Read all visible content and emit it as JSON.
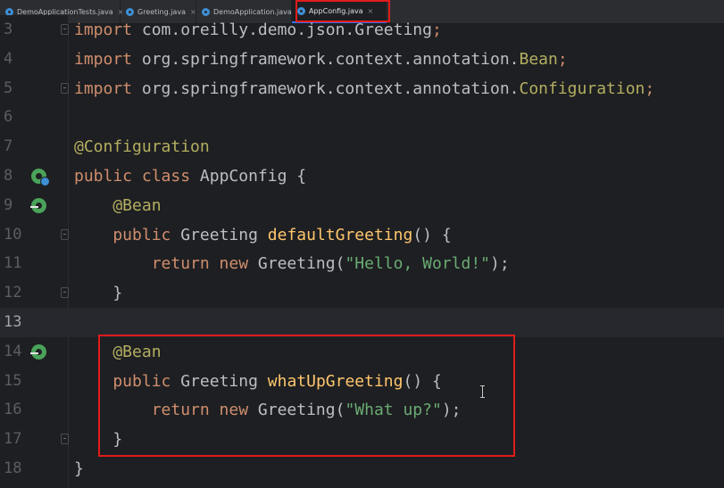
{
  "tabs": [
    {
      "label": "DemoApplicationTests.java",
      "active": false
    },
    {
      "label": "Greeting.java",
      "active": false
    },
    {
      "label": "DemoApplication.java",
      "active": false
    },
    {
      "label": "AppConfig.java",
      "active": true
    }
  ],
  "editor": {
    "current_line": "13",
    "lines": [
      {
        "num": "3",
        "tokens": [
          {
            "t": "import ",
            "c": "kw"
          },
          {
            "t": "com.oreilly.demo.json.Greeting",
            "c": "plain"
          },
          {
            "t": ";",
            "c": "kw"
          }
        ]
      },
      {
        "num": "4",
        "tokens": [
          {
            "t": "import ",
            "c": "kw"
          },
          {
            "t": "org.springframework.context.annotation.",
            "c": "plain"
          },
          {
            "t": "Bean",
            "c": "ann"
          },
          {
            "t": ";",
            "c": "kw"
          }
        ]
      },
      {
        "num": "5",
        "tokens": [
          {
            "t": "import ",
            "c": "kw"
          },
          {
            "t": "org.springframework.context.annotation.",
            "c": "plain"
          },
          {
            "t": "Configuration",
            "c": "ann"
          },
          {
            "t": ";",
            "c": "kw"
          }
        ]
      },
      {
        "num": "6",
        "tokens": []
      },
      {
        "num": "7",
        "tokens": [
          {
            "t": "@Configuration",
            "c": "ann"
          }
        ]
      },
      {
        "num": "8",
        "tokens": [
          {
            "t": "public class ",
            "c": "kw"
          },
          {
            "t": "AppConfig {",
            "c": "plain"
          }
        ]
      },
      {
        "num": "9",
        "tokens": [
          {
            "t": "    @Bean",
            "c": "ann"
          }
        ]
      },
      {
        "num": "10",
        "tokens": [
          {
            "t": "    public ",
            "c": "kw"
          },
          {
            "t": "Greeting ",
            "c": "plain"
          },
          {
            "t": "defaultGreeting",
            "c": "fn"
          },
          {
            "t": "() {",
            "c": "plain"
          }
        ]
      },
      {
        "num": "11",
        "tokens": [
          {
            "t": "        return new ",
            "c": "kw"
          },
          {
            "t": "Greeting(",
            "c": "plain"
          },
          {
            "t": "\"Hello, World!\"",
            "c": "str"
          },
          {
            "t": ");",
            "c": "plain"
          }
        ]
      },
      {
        "num": "12",
        "tokens": [
          {
            "t": "    }",
            "c": "plain"
          }
        ]
      },
      {
        "num": "13",
        "tokens": []
      },
      {
        "num": "14",
        "tokens": [
          {
            "t": "    @Bean",
            "c": "ann"
          }
        ]
      },
      {
        "num": "15",
        "tokens": [
          {
            "t": "    public ",
            "c": "kw"
          },
          {
            "t": "Greeting ",
            "c": "plain"
          },
          {
            "t": "whatUpGreeting",
            "c": "fn"
          },
          {
            "t": "() {",
            "c": "plain"
          }
        ]
      },
      {
        "num": "16",
        "tokens": [
          {
            "t": "        return new ",
            "c": "kw"
          },
          {
            "t": "Greeting(",
            "c": "plain"
          },
          {
            "t": "\"What up?\"",
            "c": "str"
          },
          {
            "t": ");",
            "c": "plain"
          }
        ]
      },
      {
        "num": "17",
        "tokens": [
          {
            "t": "    }",
            "c": "plain"
          }
        ]
      },
      {
        "num": "18",
        "tokens": [
          {
            "t": "}",
            "c": "plain"
          }
        ]
      }
    ]
  },
  "gutter_icons": [
    {
      "line": "8",
      "icon": "spring-bean-config-icon"
    },
    {
      "line": "9",
      "icon": "spring-bean-navigate-icon"
    },
    {
      "line": "14",
      "icon": "spring-bean-navigate-icon"
    }
  ],
  "fold_markers": [
    "3",
    "5",
    "10",
    "12",
    "17"
  ],
  "colors": {
    "background": "#1e1f22",
    "keyword": "#cf8e6d",
    "annotation": "#b3ae60",
    "method": "#ffc66d",
    "string": "#6aab73",
    "highlight_box": "#e11b1b"
  }
}
